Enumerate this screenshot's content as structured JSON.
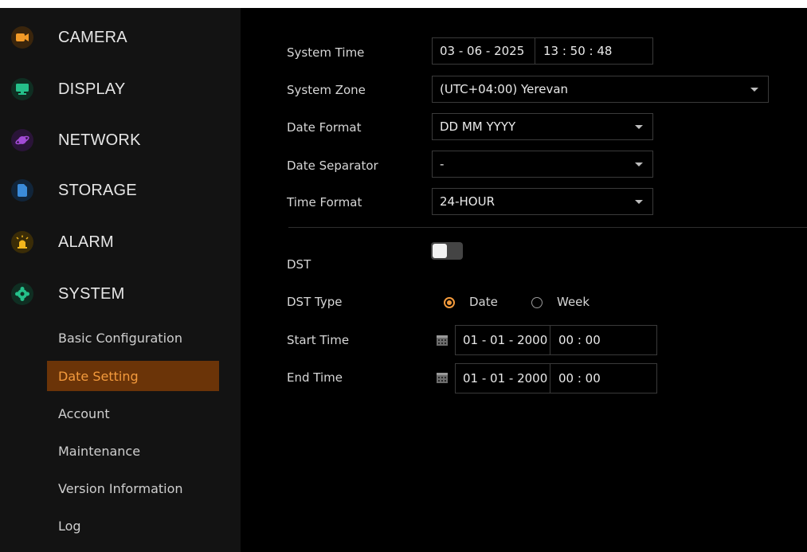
{
  "sidebar": {
    "menu": [
      {
        "label": "CAMERA",
        "icon": "camera-icon",
        "color": "#f29a27"
      },
      {
        "label": "DISPLAY",
        "icon": "monitor-icon",
        "color": "#25c08a"
      },
      {
        "label": "NETWORK",
        "icon": "planet-icon",
        "color": "#a24bd6"
      },
      {
        "label": "STORAGE",
        "icon": "storage-icon",
        "color": "#3b8bd9"
      },
      {
        "label": "ALARM",
        "icon": "alarm-light-icon",
        "color": "#f2b51c"
      },
      {
        "label": "SYSTEM",
        "icon": "gear-icon",
        "color": "#25c08a"
      }
    ],
    "submenu": [
      {
        "label": "Basic Configuration",
        "active": false
      },
      {
        "label": "Date Setting",
        "active": true
      },
      {
        "label": "Account",
        "active": false
      },
      {
        "label": "Maintenance",
        "active": false
      },
      {
        "label": "Version Information",
        "active": false
      },
      {
        "label": "Log",
        "active": false
      }
    ]
  },
  "form": {
    "system_time": {
      "label": "System Time",
      "date": "03 - 06 - 2025",
      "time": "13 : 50 : 48"
    },
    "system_zone": {
      "label": "System Zone",
      "value": "(UTC+04:00) Yerevan"
    },
    "date_format": {
      "label": "Date Format",
      "value": "DD MM YYYY"
    },
    "date_separator": {
      "label": "Date Separator",
      "value": "-"
    },
    "time_format": {
      "label": "Time Format",
      "value": "24-HOUR"
    },
    "dst": {
      "label": "DST",
      "enabled": false
    },
    "dst_type": {
      "label": "DST Type",
      "options": [
        "Date",
        "Week"
      ],
      "selected": "Date"
    },
    "start_time": {
      "label": "Start Time",
      "date": "01 - 01 - 2000",
      "time": "00 : 00"
    },
    "end_time": {
      "label": "End Time",
      "date": "01 - 01 - 2000",
      "time": "00 : 00"
    }
  },
  "colors": {
    "accent": "#f39a3c",
    "active_bg": "#6b3408",
    "sidebar_bg": "#131313",
    "content_bg": "#000000"
  }
}
